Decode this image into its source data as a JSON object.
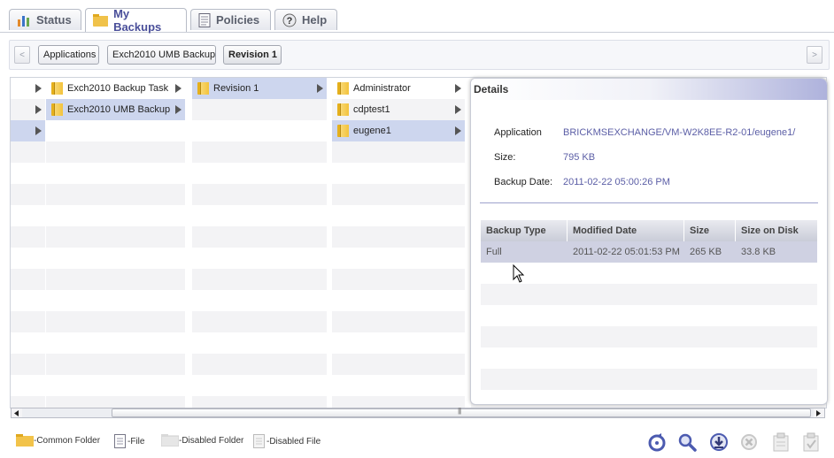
{
  "tabs": [
    {
      "label": "Status"
    },
    {
      "label": "My Backups"
    },
    {
      "label": "Policies"
    },
    {
      "label": "Help"
    }
  ],
  "breadcrumb": {
    "back_label": "<",
    "forward_label": ">",
    "items": [
      "Applications",
      "Exch2010 UMB Backup",
      "Revision 1"
    ]
  },
  "browser": {
    "col1": [
      {
        "selected": false
      },
      {
        "selected": false
      },
      {
        "selected": true
      }
    ],
    "col2": [
      {
        "label": "Exch2010 Backup Task",
        "selected": false
      },
      {
        "label": "Exch2010 UMB Backup",
        "selected": true
      }
    ],
    "col3": [
      {
        "label": "Revision 1",
        "selected": true
      }
    ],
    "col4": [
      {
        "label": "Administrator",
        "selected": false
      },
      {
        "label": "cdptest1",
        "selected": false
      },
      {
        "label": "eugene1",
        "selected": true
      }
    ]
  },
  "details": {
    "title": "Details",
    "application_label": "Application",
    "application_value": "BRICKMSEXCHANGE/VM-W2K8EE-R2-01/eugene1/",
    "size_label": "Size:",
    "size_value": "795 KB",
    "backup_date_label": "Backup Date:",
    "backup_date_value": "2011-02-22 05:00:26 PM",
    "table": {
      "columns": [
        "Backup Type",
        "Modified Date",
        "Size",
        "Size on Disk"
      ],
      "rows": [
        [
          "Full",
          "2011-02-22 05:01:53 PM",
          "265 KB",
          "33.8 KB"
        ]
      ]
    }
  },
  "scrollbar": {
    "grip": "|||"
  },
  "legend": {
    "common_folder": "-Common Folder",
    "file": "-File",
    "disabled_folder": "-Disabled Folder",
    "disabled_file": "-Disabled File"
  },
  "toolbar_icons": [
    "restore-icon",
    "search-icon",
    "download-icon",
    "cancel-icon",
    "clipboard-icon",
    "clipboard-check-icon"
  ],
  "colors": {
    "accent": "#4a4f9a",
    "link": "#5b5ea6",
    "selection": "#cdd6ee"
  }
}
